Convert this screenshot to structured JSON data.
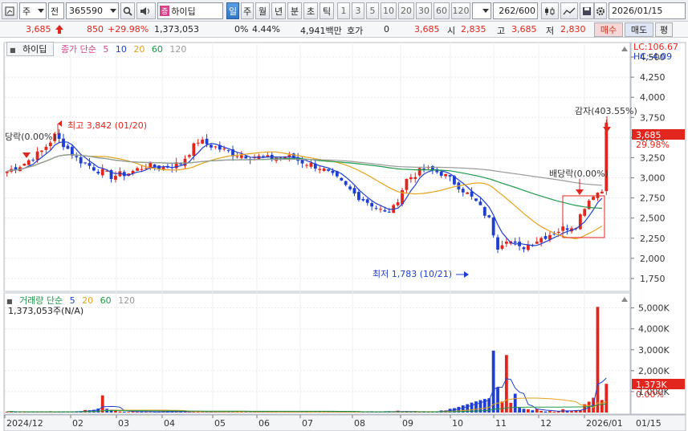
{
  "toolbar": {
    "market_code": "주",
    "market_type": "전",
    "code": "365590",
    "stock_name": "하이딥",
    "periods": [
      "일",
      "주",
      "월",
      "년",
      "분",
      "초",
      "틱"
    ],
    "active_period": "일",
    "intervals": [
      "1",
      "3",
      "5",
      "10",
      "20",
      "30",
      "60",
      "120"
    ],
    "count": "262",
    "max_count": "/600",
    "date": "2026/01/15"
  },
  "quote": {
    "price": "3,685",
    "change": "850",
    "change_pct": "+29.98%",
    "volume": "1,373,053",
    "ratio_label": "0%",
    "ratio_value": "4.44%",
    "amount": "4,941백만",
    "bid_label": "호가",
    "bid_value": "0",
    "ask_value": "3,685",
    "open_label": "시",
    "open_value": "2,835",
    "high_label": "고",
    "high_value": "3,685",
    "low_label": "저",
    "low_value": "2,830",
    "buy_label": "매수",
    "sell_label": "매도",
    "eval_label": "평"
  },
  "price_panel": {
    "name": "하이딥",
    "legend_title": "종가 단순",
    "ma_periods": [
      "5",
      "10",
      "20",
      "60",
      "120"
    ],
    "lc_label": "LC:106.67",
    "hc_label": "HC:-4.09",
    "current_price_tag": "3,685",
    "current_pct_tag": "29.98%"
  },
  "volume_panel": {
    "legend_title": "거래량 단순",
    "ma_periods": [
      "5",
      "20",
      "60",
      "120"
    ],
    "volume_text": "1,373,053주(N/A)",
    "current_volume_tag": "1,373K",
    "current_pct_tag": "0.00%"
  },
  "annotations": {
    "high": "최고 3,842 (01/20)",
    "low": "최저 1,783 (10/21)",
    "reduction": "감자(403.55%)",
    "dividend_drop": "배당락(0.00%)",
    "dividend_drop_left": "당락(0.00%)"
  },
  "colors": {
    "up": "#e3261d",
    "down": "#1f3fd2",
    "ma5": "#1f3fd2",
    "ma20": "#e6a21a",
    "ma60": "#1e9a4a",
    "ma120": "#9a9a9a"
  },
  "chart_data": {
    "type": "candlestick",
    "x_ticks": [
      "2024/12",
      "02",
      "03",
      "04",
      "05",
      "06",
      "07",
      "08",
      "09",
      "10",
      "11",
      "12",
      "2026/01",
      "01/15"
    ],
    "price_ticks": [
      1750,
      2000,
      2250,
      2500,
      2750,
      3000,
      3250,
      3500,
      3750,
      4000,
      4250,
      4500
    ],
    "price_ylim": [
      1620,
      4650
    ],
    "volume_ticks": [
      "1,000K",
      "2,000K",
      "3,000K",
      "4,000K",
      "5,000K"
    ],
    "volume_ylim": [
      0,
      5600
    ],
    "close_points": [
      [
        0,
        3080
      ],
      [
        4,
        3180
      ],
      [
        8,
        3330
      ],
      [
        11,
        3520
      ],
      [
        13,
        3420
      ],
      [
        16,
        3240
      ],
      [
        20,
        3120
      ],
      [
        24,
        3020
      ],
      [
        28,
        3060
      ],
      [
        32,
        3150
      ],
      [
        36,
        3130
      ],
      [
        40,
        3180
      ],
      [
        44,
        3460
      ],
      [
        48,
        3380
      ],
      [
        52,
        3300
      ],
      [
        56,
        3270
      ],
      [
        60,
        3240
      ],
      [
        64,
        3270
      ],
      [
        68,
        3200
      ],
      [
        72,
        3130
      ],
      [
        76,
        2980
      ],
      [
        80,
        2800
      ],
      [
        84,
        2670
      ],
      [
        87,
        2560
      ],
      [
        89,
        2620
      ],
      [
        92,
        2980
      ],
      [
        96,
        3110
      ],
      [
        100,
        3060
      ],
      [
        104,
        2900
      ],
      [
        108,
        2700
      ],
      [
        111,
        2480
      ],
      [
        113,
        2150
      ],
      [
        115,
        2250
      ],
      [
        118,
        2120
      ],
      [
        121,
        2200
      ],
      [
        124,
        2280
      ],
      [
        128,
        2370
      ],
      [
        131,
        2420
      ],
      [
        133,
        2650
      ],
      [
        135,
        2800
      ],
      [
        137,
        2835
      ],
      [
        138,
        3685
      ]
    ],
    "volume_points": [
      [
        0,
        40
      ],
      [
        10,
        60
      ],
      [
        18,
        120
      ],
      [
        22,
        820
      ],
      [
        26,
        50
      ],
      [
        40,
        60
      ],
      [
        60,
        40
      ],
      [
        80,
        70
      ],
      [
        90,
        90
      ],
      [
        100,
        100
      ],
      [
        112,
        2960
      ],
      [
        113,
        1200
      ],
      [
        115,
        2750
      ],
      [
        117,
        900
      ],
      [
        122,
        180
      ],
      [
        128,
        160
      ],
      [
        133,
        400
      ],
      [
        134,
        520
      ],
      [
        136,
        5050
      ],
      [
        137,
        600
      ],
      [
        138,
        1373
      ]
    ]
  }
}
